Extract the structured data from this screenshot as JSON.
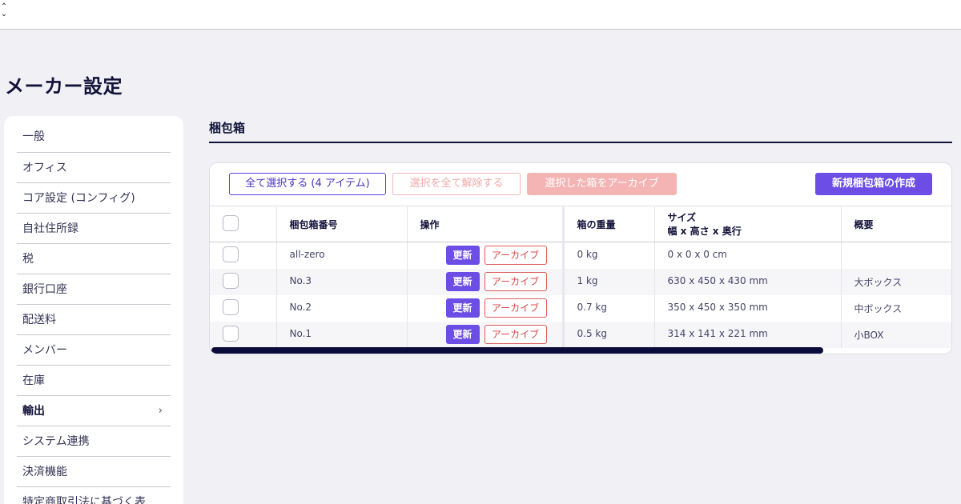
{
  "topbar": {
    "collapse_icon": "chevron-up-down-icon"
  },
  "page_title": "メーカー設定",
  "sidebar": {
    "items": [
      {
        "label": "一般"
      },
      {
        "label": "オフィス"
      },
      {
        "label": "コア設定 (コンフィグ)"
      },
      {
        "label": "自社住所録"
      },
      {
        "label": "税"
      },
      {
        "label": "銀行口座"
      },
      {
        "label": "配送料"
      },
      {
        "label": "メンバー"
      },
      {
        "label": "在庫"
      },
      {
        "label": "輸出",
        "active": true,
        "icon": "chevron-right-icon"
      },
      {
        "label": "システム連携"
      },
      {
        "label": "決済機能"
      },
      {
        "label": "特定商取引法に基づく表"
      }
    ],
    "chevron_glyph": "›"
  },
  "section": {
    "title": "梱包箱"
  },
  "toolbar": {
    "select_all": "全て選択する (4 アイテム)",
    "deselect_all": "選択を全て解除する",
    "archive_selected": "選択した箱をアーカイブ",
    "new_box": "新規梱包箱の作成"
  },
  "table": {
    "headers": {
      "box_number": "梱包箱番号",
      "actions": "操作",
      "weight": "箱の重量",
      "size": "サイズ",
      "size_sub": "幅 x 高さ x 奥行",
      "summary": "概要"
    },
    "update_label": "更新",
    "archive_label": "アーカイブ",
    "rows": [
      {
        "number": "all-zero",
        "weight": "0 kg",
        "size": "0 x 0 x 0 cm",
        "summary": ""
      },
      {
        "number": "No.3",
        "weight": "1 kg",
        "size": "630 x 450 x 430 mm",
        "summary": "大ボックス"
      },
      {
        "number": "No.2",
        "weight": "0.7 kg",
        "size": "350 x 450 x 350 mm",
        "summary": "中ボックス"
      },
      {
        "number": "No.1",
        "weight": "0.5 kg",
        "size": "314 x 141 x 221 mm",
        "summary": "小BOX"
      }
    ]
  },
  "colors": {
    "primary": "#6c4ee6",
    "danger": "#d94848",
    "navy": "#12123a"
  }
}
